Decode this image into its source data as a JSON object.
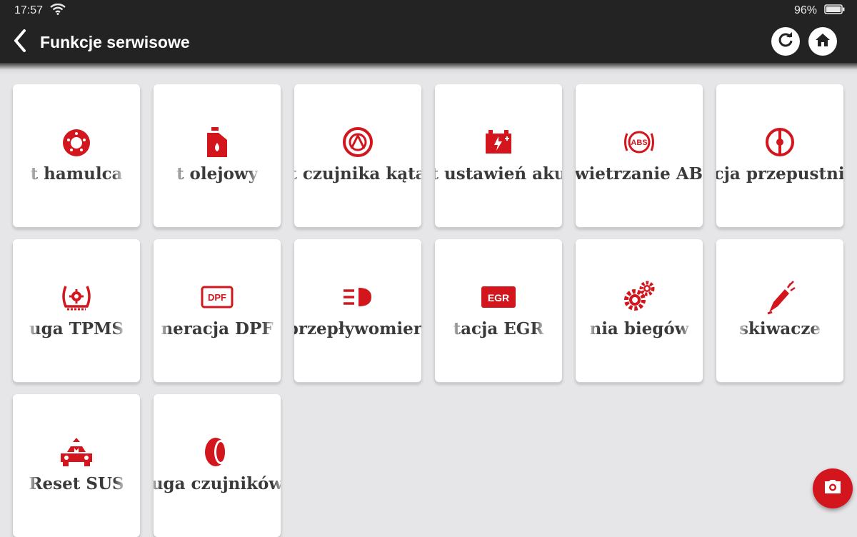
{
  "status": {
    "time": "17:57",
    "battery": "96%"
  },
  "appbar": {
    "title": "Funkcje serwisowe"
  },
  "icons": {
    "back": "chevron-left-icon",
    "refresh": "refresh-icon",
    "home": "home-icon",
    "screenshot": "camera-icon"
  },
  "accent_color": "#d3161d",
  "tiles": [
    {
      "label": "t hamulca",
      "icon": "brake-disc-icon"
    },
    {
      "label": "t olejowy",
      "icon": "oil-can-icon"
    },
    {
      "label": "t czujnika kąta",
      "icon": "steering-angle-icon"
    },
    {
      "label": "t ustawień aku",
      "icon": "battery-icon"
    },
    {
      "label": "owietrzanie ABS",
      "icon": "abs-icon"
    },
    {
      "label": "tacja przepustnicy",
      "icon": "throttle-icon"
    },
    {
      "label": "uga TPMS",
      "icon": "tpms-icon"
    },
    {
      "label": "neracja DPF",
      "icon": "dpf-icon"
    },
    {
      "label": "t przepływomierza",
      "icon": "headlight-icon"
    },
    {
      "label": "tacja EGR",
      "icon": "egr-icon"
    },
    {
      "label": "nia biegów",
      "icon": "gears-icon"
    },
    {
      "label": "skiwacze",
      "icon": "injector-icon"
    },
    {
      "label": "Reset SUS",
      "icon": "suspension-icon"
    },
    {
      "label": "uga czujników",
      "icon": "tire-icon"
    }
  ]
}
